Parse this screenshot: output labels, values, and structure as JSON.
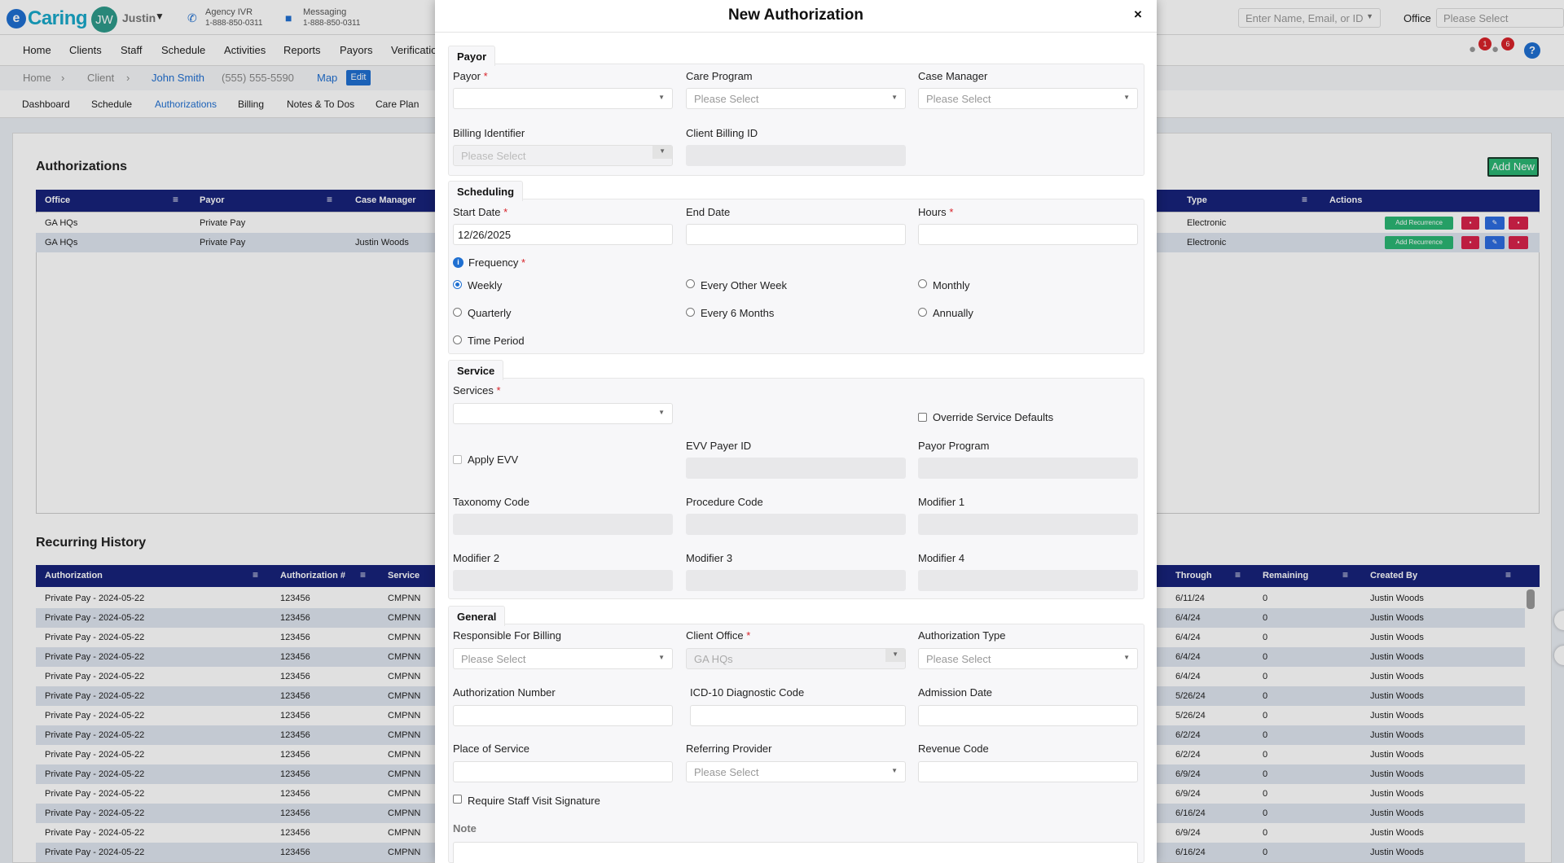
{
  "app": {
    "logo_letter": "e",
    "logo_text": "Caring",
    "user_initials": "JW",
    "user_name": "Justin"
  },
  "contacts": {
    "ivr_label": "Agency IVR",
    "ivr_phone": "1-888-850-0311",
    "msg_label": "Messaging",
    "msg_phone": "1-888-850-0311"
  },
  "search": {
    "placeholder": "Enter Name, Email, or ID"
  },
  "office": {
    "label": "Office",
    "placeholder": "Please Select"
  },
  "nav": {
    "home": "Home",
    "clients": "Clients",
    "staff": "Staff",
    "schedule": "Schedule",
    "activities": "Activities",
    "reports": "Reports",
    "payors": "Payors",
    "verification": "Verificatio"
  },
  "badges": {
    "messages": "1",
    "alerts": "6",
    "help": "?"
  },
  "breadcrumb": {
    "home": "Home",
    "client": "Client",
    "name": "John Smith",
    "phone": "(555) 555-5590",
    "map": "Map",
    "edit": "Edit"
  },
  "subnav": {
    "dashboard": "Dashboard",
    "schedule": "Schedule",
    "authorizations": "Authorizations",
    "billing": "Billing",
    "notes": "Notes & To Dos",
    "care_plan": "Care Plan"
  },
  "authorizations": {
    "title": "Authorizations",
    "add_new": "Add New",
    "headers": {
      "office": "Office",
      "payor": "Payor",
      "case_manager": "Case Manager",
      "type": "Type",
      "actions": "Actions"
    },
    "add_recurrence": "Add Recurrence",
    "rows": [
      {
        "office": "GA HQs",
        "payor": "Private Pay",
        "case_manager": "",
        "type": "Electronic"
      },
      {
        "office": "GA HQs",
        "payor": "Private Pay",
        "case_manager": "Justin Woods",
        "type": "Electronic"
      }
    ]
  },
  "recurring": {
    "title": "Recurring History",
    "headers": {
      "authorization": "Authorization",
      "auth_num": "Authorization #",
      "service": "Service",
      "through": "Through",
      "remaining": "Remaining",
      "created_by": "Created By"
    },
    "rows": [
      {
        "authorization": "Private Pay - 2024-05-22",
        "auth_num": "123456",
        "service": "CMPNN",
        "through": "6/11/24",
        "remaining": "0",
        "created_by": "Justin Woods"
      },
      {
        "authorization": "Private Pay - 2024-05-22",
        "auth_num": "123456",
        "service": "CMPNN",
        "through": "6/4/24",
        "remaining": "0",
        "created_by": "Justin Woods"
      },
      {
        "authorization": "Private Pay - 2024-05-22",
        "auth_num": "123456",
        "service": "CMPNN",
        "through": "6/4/24",
        "remaining": "0",
        "created_by": "Justin Woods"
      },
      {
        "authorization": "Private Pay - 2024-05-22",
        "auth_num": "123456",
        "service": "CMPNN",
        "through": "6/4/24",
        "remaining": "0",
        "created_by": "Justin Woods"
      },
      {
        "authorization": "Private Pay - 2024-05-22",
        "auth_num": "123456",
        "service": "CMPNN",
        "through": "6/4/24",
        "remaining": "0",
        "created_by": "Justin Woods"
      },
      {
        "authorization": "Private Pay - 2024-05-22",
        "auth_num": "123456",
        "service": "CMPNN",
        "through": "5/26/24",
        "remaining": "0",
        "created_by": "Justin Woods"
      },
      {
        "authorization": "Private Pay - 2024-05-22",
        "auth_num": "123456",
        "service": "CMPNN",
        "through": "5/26/24",
        "remaining": "0",
        "created_by": "Justin Woods"
      },
      {
        "authorization": "Private Pay - 2024-05-22",
        "auth_num": "123456",
        "service": "CMPNN",
        "through": "6/2/24",
        "remaining": "0",
        "created_by": "Justin Woods"
      },
      {
        "authorization": "Private Pay - 2024-05-22",
        "auth_num": "123456",
        "service": "CMPNN",
        "through": "6/2/24",
        "remaining": "0",
        "created_by": "Justin Woods"
      },
      {
        "authorization": "Private Pay - 2024-05-22",
        "auth_num": "123456",
        "service": "CMPNN",
        "through": "6/9/24",
        "remaining": "0",
        "created_by": "Justin Woods"
      },
      {
        "authorization": "Private Pay - 2024-05-22",
        "auth_num": "123456",
        "service": "CMPNN",
        "through": "6/9/24",
        "remaining": "0",
        "created_by": "Justin Woods"
      },
      {
        "authorization": "Private Pay - 2024-05-22",
        "auth_num": "123456",
        "service": "CMPNN",
        "through": "6/16/24",
        "remaining": "0",
        "created_by": "Justin Woods"
      },
      {
        "authorization": "Private Pay - 2024-05-22",
        "auth_num": "123456",
        "service": "CMPNN",
        "through": "6/9/24",
        "remaining": "0",
        "created_by": "Justin Woods"
      },
      {
        "authorization": "Private Pay - 2024-05-22",
        "auth_num": "123456",
        "service": "CMPNN",
        "through": "6/16/24",
        "remaining": "0",
        "created_by": "Justin Woods"
      }
    ]
  },
  "modal": {
    "title": "New Authorization",
    "close": "×",
    "payor": {
      "section": "Payor",
      "payor_label": "Payor",
      "care_program_label": "Care Program",
      "care_program_ph": "Please Select",
      "case_manager_label": "Case Manager",
      "case_manager_ph": "Please Select",
      "billing_identifier_label": "Billing Identifier",
      "billing_identifier_ph": "Please Select",
      "client_billing_id_label": "Client Billing ID"
    },
    "scheduling": {
      "section": "Scheduling",
      "start_date_label": "Start Date",
      "start_date_value": "12/26/2025",
      "end_date_label": "End Date",
      "hours_label": "Hours",
      "frequency_label": "Frequency",
      "options": {
        "weekly": "Weekly",
        "every_other_week": "Every Other Week",
        "monthly": "Monthly",
        "quarterly": "Quarterly",
        "every_6_months": "Every 6 Months",
        "annually": "Annually",
        "time_period": "Time Period"
      }
    },
    "service": {
      "section": "Service",
      "services_label": "Services",
      "override_label": "Override Service Defaults",
      "apply_evv_label": "Apply EVV",
      "evv_payer_id_label": "EVV Payer ID",
      "payor_program_label": "Payor Program",
      "taxonomy_label": "Taxonomy Code",
      "procedure_label": "Procedure Code",
      "modifier1_label": "Modifier 1",
      "modifier2_label": "Modifier 2",
      "modifier3_label": "Modifier 3",
      "modifier4_label": "Modifier 4"
    },
    "general": {
      "section": "General",
      "responsible_label": "Responsible For Billing",
      "responsible_ph": "Please Select",
      "client_office_label": "Client Office",
      "client_office_value": "GA HQs",
      "auth_type_label": "Authorization Type",
      "auth_type_ph": "Please Select",
      "auth_number_label": "Authorization Number",
      "icd_label": "ICD-10 Diagnostic Code",
      "admission_label": "Admission Date",
      "place_label": "Place of Service",
      "referring_label": "Referring Provider",
      "referring_ph": "Please Select",
      "revenue_label": "Revenue Code",
      "require_sig_label": "Require Staff Visit Signature",
      "note_label": "Note"
    }
  },
  "required_mark": "*"
}
